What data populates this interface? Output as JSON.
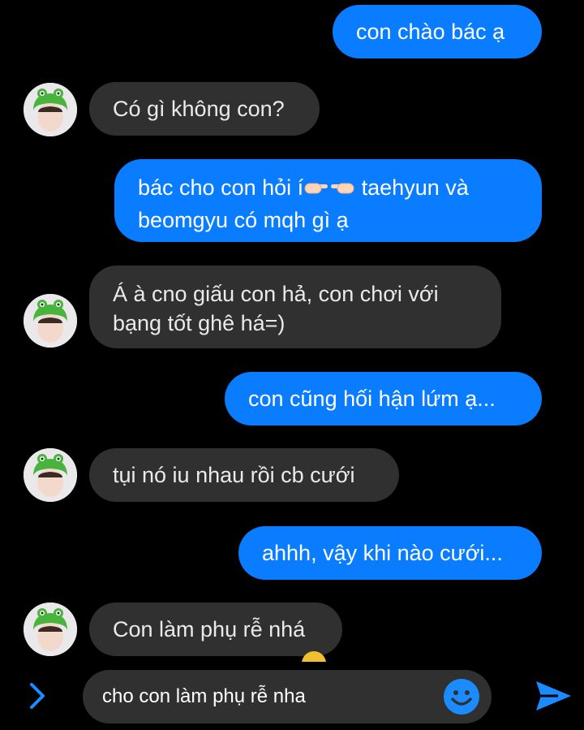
{
  "messages": [
    {
      "direction": "outgoing",
      "text": "con chào bác ạ"
    },
    {
      "direction": "incoming",
      "text": "Có gì không con?"
    },
    {
      "direction": "outgoing",
      "line1_before": "bác cho con hỏi í",
      "line1_after": " taehyun và",
      "line2": "beomgyu có mqh gì ạ",
      "emoji": [
        "pointing-left-icon",
        "pointing-right-icon"
      ]
    },
    {
      "direction": "incoming",
      "line1": "Á à cno giấu con hả, con chơi với",
      "line2": "bạng tốt ghê há=)"
    },
    {
      "direction": "outgoing",
      "text": "con cũng hối hận lứm ạ..."
    },
    {
      "direction": "incoming",
      "text": "tụi nó iu nhau rồi cb cưới"
    },
    {
      "direction": "outgoing",
      "text": "ahhh, vậy khi nào cưới..."
    },
    {
      "direction": "incoming",
      "text": "Con làm phụ rễ nhá"
    }
  ],
  "composer": {
    "value": "cho con làm phụ rễ nha",
    "icons": [
      "chevron-right-icon",
      "emoji-icon",
      "send-icon"
    ]
  },
  "colors": {
    "background": "#000000",
    "outgoing_bubble": "#0a7cff",
    "incoming_bubble": "#303030",
    "accent": "#1b8cff"
  }
}
